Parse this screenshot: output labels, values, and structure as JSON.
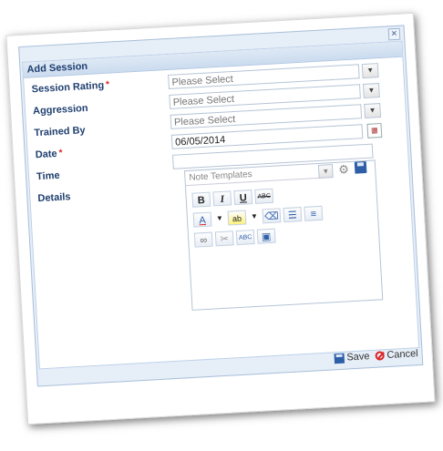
{
  "dialog": {
    "close_glyph": "×",
    "title": "Add Session"
  },
  "fields": {
    "session_rating": {
      "label": "Session Rating",
      "required_mark": "*",
      "placeholder": "Please Select"
    },
    "aggression": {
      "label": "Aggression",
      "placeholder": "Please Select"
    },
    "trained_by": {
      "label": "Trained By",
      "placeholder": "Please Select"
    },
    "date": {
      "label": "Date",
      "required_mark": "*",
      "value": "06/05/2014"
    },
    "time": {
      "label": "Time",
      "value": ""
    },
    "details": {
      "label": "Details"
    }
  },
  "editor": {
    "template_placeholder": "Note Templates",
    "toolbar": {
      "bold": "B",
      "italic": "I",
      "underline": "U",
      "strikethrough": "ABC",
      "font_color": "A",
      "highlight": "ab",
      "spellcheck": "ABC"
    }
  },
  "footer": {
    "save_label": "Save",
    "cancel_label": "Cancel"
  },
  "colors": {
    "label_blue": "#1e3e6e",
    "required_red": "#dd2222",
    "header_blue": "#cbdcef"
  }
}
